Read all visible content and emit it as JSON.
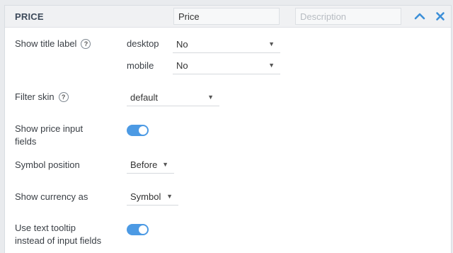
{
  "header": {
    "title": "PRICE",
    "name_value": "Price",
    "name_placeholder": "",
    "description_value": "",
    "description_placeholder": "Description",
    "collapse_icon": "chevron-up-icon",
    "close_icon": "close-icon",
    "accent_color": "#3c8fd8"
  },
  "rows": {
    "show_title": {
      "label": "Show title label",
      "help": "?",
      "desktop_label": "desktop",
      "desktop_value": "No",
      "mobile_label": "mobile",
      "mobile_value": "No"
    },
    "filter_skin": {
      "label": "Filter skin",
      "help": "?",
      "value": "default"
    },
    "show_price_inputs": {
      "label_line1": "Show price input",
      "label_line2": "fields",
      "enabled": true
    },
    "symbol_position": {
      "label": "Symbol position",
      "value": "Before"
    },
    "show_currency": {
      "label": "Show currency as",
      "value": "Symbol"
    },
    "text_tooltip": {
      "label_line1": "Use text tooltip",
      "label_line2": "instead of input fields",
      "enabled": true
    }
  },
  "toggle_color": "#4c9ae4",
  "caret_glyph": "▼"
}
